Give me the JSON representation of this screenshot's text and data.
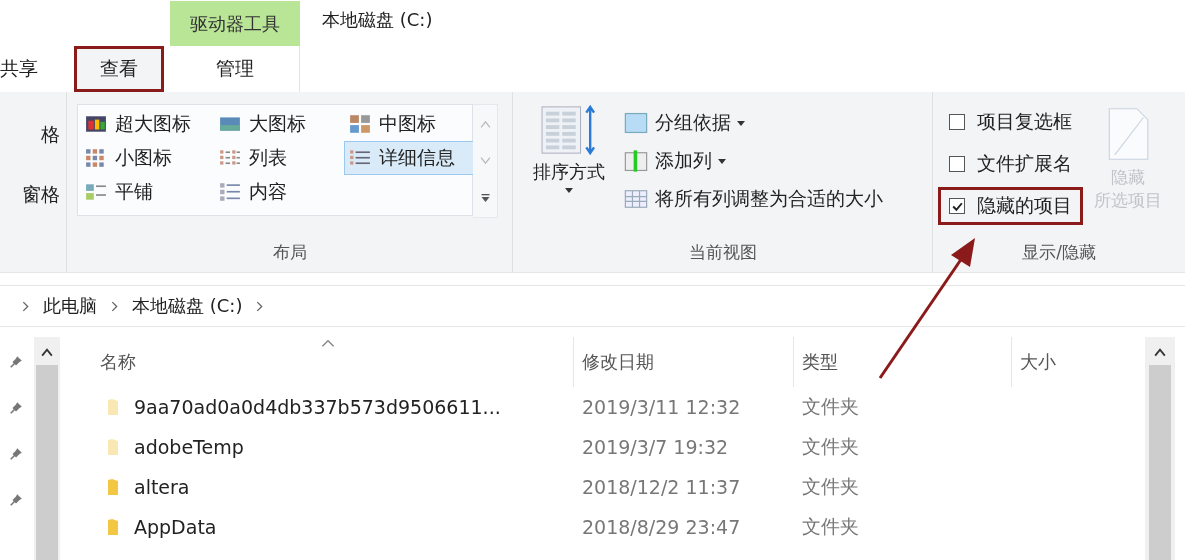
{
  "ribbon_tabs": {
    "context_header": "驱动器工具",
    "window_title": "本地磁盘 (C:)",
    "tabs": [
      {
        "label": "共享",
        "selected": false,
        "highlighted": false
      },
      {
        "label": "查看",
        "selected": true,
        "highlighted": true
      },
      {
        "label": "管理",
        "selected": false,
        "highlighted": false
      }
    ]
  },
  "ribbon": {
    "panes_group": {
      "items": [
        "格",
        "窗格"
      ]
    },
    "layout_group": {
      "label": "布局",
      "options": [
        {
          "label": "超大图标",
          "selected": false
        },
        {
          "label": "大图标",
          "selected": false
        },
        {
          "label": "中图标",
          "selected": false
        },
        {
          "label": "小图标",
          "selected": false
        },
        {
          "label": "列表",
          "selected": false
        },
        {
          "label": "详细信息",
          "selected": true
        },
        {
          "label": "平铺",
          "selected": false
        },
        {
          "label": "内容",
          "selected": false
        }
      ]
    },
    "current_view": {
      "label": "当前视图",
      "sort_button": "排序方式",
      "commands": [
        {
          "label": "分组依据",
          "dropdown": true
        },
        {
          "label": "添加列",
          "dropdown": true
        },
        {
          "label": "将所有列调整为合适的大小",
          "dropdown": false
        }
      ]
    },
    "show_hide": {
      "label": "显示/隐藏",
      "options": [
        {
          "label": "项目复选框",
          "checked": false,
          "highlighted": false
        },
        {
          "label": "文件扩展名",
          "checked": false,
          "highlighted": false
        },
        {
          "label": "隐藏的项目",
          "checked": true,
          "highlighted": true
        }
      ],
      "hide_button": {
        "label_lines": [
          "隐藏",
          "所选项目"
        ],
        "disabled": true
      }
    }
  },
  "address_bar": {
    "crumbs": [
      "此电脑",
      "本地磁盘 (C:)"
    ]
  },
  "file_list": {
    "columns": [
      {
        "label": "名称",
        "sorted": true
      },
      {
        "label": "修改日期",
        "sorted": false
      },
      {
        "label": "类型",
        "sorted": false
      },
      {
        "label": "大小",
        "sorted": false
      }
    ],
    "rows": [
      {
        "name": "9aa70ad0a0d4db337b573d9506611...",
        "modified": "2019/3/11 12:32",
        "type": "文件夹",
        "hidden": true
      },
      {
        "name": "adobeTemp",
        "modified": "2019/3/7 19:32",
        "type": "文件夹",
        "hidden": true
      },
      {
        "name": "altera",
        "modified": "2018/12/2 11:37",
        "type": "文件夹",
        "hidden": false
      },
      {
        "name": "AppData",
        "modified": "2018/8/29 23:47",
        "type": "文件夹",
        "hidden": false
      }
    ]
  },
  "annotation": {
    "arrow": true
  }
}
